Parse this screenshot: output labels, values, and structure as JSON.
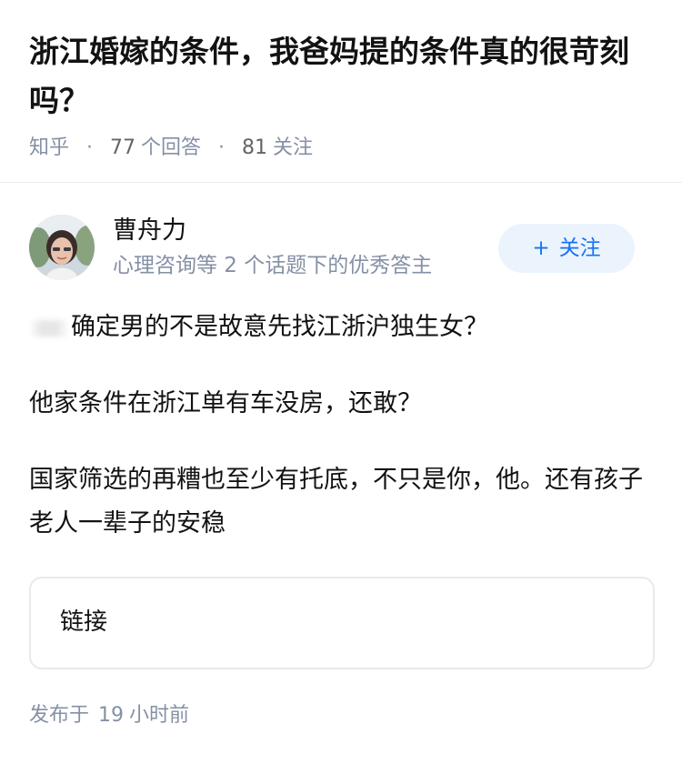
{
  "question": {
    "title": "浙江婚嫁的条件，我爸妈提的条件真的很苛刻吗？",
    "source": "知乎",
    "separator": "·",
    "answers_count": "77",
    "answers_label": "个回答",
    "followers_count": "81",
    "followers_label": "关注"
  },
  "author": {
    "name": "曹舟力",
    "bio": "心理咨询等 2 个话题下的优秀答主",
    "follow_plus": "+",
    "follow_label": "关注"
  },
  "answer": {
    "paragraphs": [
      "确定男的不是故意先找江浙沪独生女？",
      "他家条件在浙江单有车没房，还敢？",
      "国家筛选的再糟也至少有托底，不只是你，他。还有孩子老人一辈子的安稳"
    ],
    "link_card_label": "链接"
  },
  "footer": {
    "publish_prefix": "发布于",
    "publish_number": "19",
    "publish_unit": "小时前"
  },
  "colors": {
    "accent": "#1772f6",
    "follow_bg": "#ebf4fd",
    "meta_gray": "#8590a6",
    "text": "#121212"
  }
}
